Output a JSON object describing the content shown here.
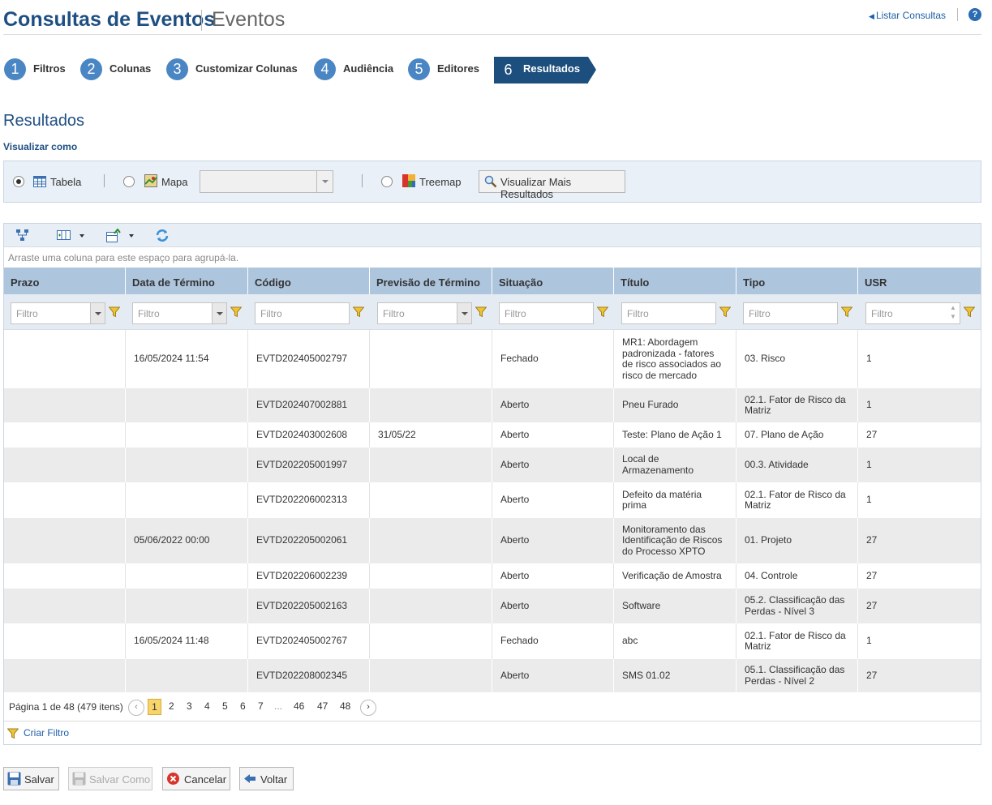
{
  "header": {
    "title": "Consultas de Eventos",
    "subtitle": "Eventos",
    "list_link": "Listar Consultas",
    "help": "?"
  },
  "steps": [
    {
      "num": "1",
      "label": "Filtros"
    },
    {
      "num": "2",
      "label": "Colunas"
    },
    {
      "num": "3",
      "label": "Customizar Colunas"
    },
    {
      "num": "4",
      "label": "Audiência"
    },
    {
      "num": "5",
      "label": "Editores"
    },
    {
      "num": "6",
      "label": "Resultados",
      "active": true
    }
  ],
  "section_title": "Resultados",
  "view_as_label": "Visualizar como",
  "view_options": {
    "table": "Tabela",
    "map": "Mapa",
    "treemap": "Treemap",
    "selected": "Tabela",
    "more_results_button": "Visualizar Mais Resultados"
  },
  "grid": {
    "group_hint": "Arraste uma coluna para este espaço para agrupá-la.",
    "filter_placeholder": "Filtro",
    "columns": [
      "Prazo",
      "Data de Término",
      "Código",
      "Previsão de Término",
      "Situação",
      "Título",
      "Tipo",
      "USR"
    ],
    "rows": [
      {
        "prazo": "",
        "data_termino": "16/05/2024 11:54",
        "codigo": "EVTD202405002797",
        "previsao": "",
        "situacao": "Fechado",
        "titulo": "MR1: Abordagem padronizada - fatores de risco associados ao risco de mercado",
        "tipo": "03. Risco",
        "usr": "1"
      },
      {
        "prazo": "",
        "data_termino": "",
        "codigo": "EVTD202407002881",
        "previsao": "",
        "situacao": "Aberto",
        "titulo": "Pneu Furado",
        "tipo": "02.1. Fator de Risco da Matriz",
        "usr": "1"
      },
      {
        "prazo": "",
        "data_termino": "",
        "codigo": "EVTD202403002608",
        "previsao": "31/05/22",
        "situacao": "Aberto",
        "titulo": "Teste: Plano de Ação 1",
        "tipo": "07. Plano de Ação",
        "usr": "27"
      },
      {
        "prazo": "",
        "data_termino": "",
        "codigo": "EVTD202205001997",
        "previsao": "",
        "situacao": "Aberto",
        "titulo": "Local de Armazenamento",
        "tipo": "00.3. Atividade",
        "usr": "1"
      },
      {
        "prazo": "",
        "data_termino": "",
        "codigo": "EVTD202206002313",
        "previsao": "",
        "situacao": "Aberto",
        "titulo": "Defeito da matéria prima",
        "tipo": "02.1. Fator de Risco da Matriz",
        "usr": "1"
      },
      {
        "prazo": "",
        "data_termino": "05/06/2022 00:00",
        "codigo": "EVTD202205002061",
        "previsao": "",
        "situacao": "Aberto",
        "titulo": "Monitoramento das Identificação de Riscos do Processo XPTO",
        "tipo": "01. Projeto",
        "usr": "27"
      },
      {
        "prazo": "",
        "data_termino": "",
        "codigo": "EVTD202206002239",
        "previsao": "",
        "situacao": "Aberto",
        "titulo": "Verificação de Amostra",
        "tipo": "04. Controle",
        "usr": "27"
      },
      {
        "prazo": "",
        "data_termino": "",
        "codigo": "EVTD202205002163",
        "previsao": "",
        "situacao": "Aberto",
        "titulo": "Software",
        "tipo": "05.2. Classificação das Perdas - Nível 3",
        "usr": "27"
      },
      {
        "prazo": "",
        "data_termino": "16/05/2024 11:48",
        "codigo": "EVTD202405002767",
        "previsao": "",
        "situacao": "Fechado",
        "titulo": "abc",
        "tipo": "02.1. Fator de Risco da Matriz",
        "usr": "1"
      },
      {
        "prazo": "",
        "data_termino": "",
        "codigo": "EVTD202208002345",
        "previsao": "",
        "situacao": "Aberto",
        "titulo": "SMS 01.02",
        "tipo": "05.1. Classificação das Perdas - Nível 2",
        "usr": "27"
      }
    ],
    "pager": {
      "info": "Página 1 de 48 (479 itens)",
      "pages": [
        "1",
        "2",
        "3",
        "4",
        "5",
        "6",
        "7",
        "...",
        "46",
        "47",
        "48"
      ],
      "current": "1"
    },
    "create_filter": "Criar Filtro"
  },
  "footer_buttons": {
    "save": "Salvar",
    "save_as": "Salvar Como",
    "cancel": "Cancelar",
    "back": "Voltar"
  },
  "colors": {
    "brand_blue": "#1f4f82",
    "step_blue": "#4a86c4",
    "active_step": "#1d4f7e",
    "header_row": "#aec5de",
    "page_highlight": "#f7d56b"
  }
}
